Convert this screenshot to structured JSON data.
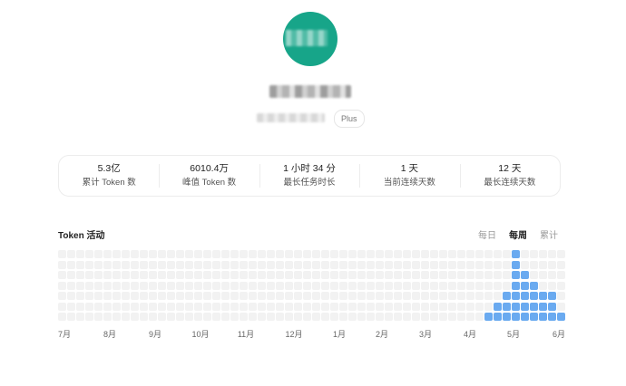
{
  "profile": {
    "plan_badge": "Plus"
  },
  "stats": [
    {
      "value": "5.3亿",
      "label": "累计 Token 数"
    },
    {
      "value": "6010.4万",
      "label": "峰值 Token 数"
    },
    {
      "value": "1 小时 34 分",
      "label": "最长任务时长"
    },
    {
      "value": "1 天",
      "label": "当前连续天数"
    },
    {
      "value": "12 天",
      "label": "最长连续天数"
    }
  ],
  "activity": {
    "title": "Token 活动",
    "tabs": [
      {
        "label": "每日",
        "active": false
      },
      {
        "label": "每周",
        "active": true
      },
      {
        "label": "累计",
        "active": false
      }
    ],
    "weeks": 56,
    "rows": 7,
    "active_cells": [
      [
        47,
        6
      ],
      [
        48,
        5
      ],
      [
        48,
        6
      ],
      [
        49,
        4
      ],
      [
        49,
        5
      ],
      [
        49,
        6
      ],
      [
        50,
        0
      ],
      [
        50,
        1
      ],
      [
        50,
        2
      ],
      [
        50,
        3
      ],
      [
        50,
        4
      ],
      [
        50,
        5
      ],
      [
        50,
        6
      ],
      [
        51,
        2
      ],
      [
        51,
        3
      ],
      [
        51,
        4
      ],
      [
        51,
        5
      ],
      [
        51,
        6
      ],
      [
        52,
        3
      ],
      [
        52,
        4
      ],
      [
        52,
        5
      ],
      [
        52,
        6
      ],
      [
        53,
        4
      ],
      [
        53,
        5
      ],
      [
        53,
        6
      ],
      [
        54,
        4
      ],
      [
        54,
        5
      ],
      [
        54,
        6
      ],
      [
        55,
        6
      ]
    ],
    "months": [
      {
        "label": "7月",
        "week": 0.5
      },
      {
        "label": "8月",
        "week": 5.5
      },
      {
        "label": "9月",
        "week": 10.5
      },
      {
        "label": "10月",
        "week": 15.5
      },
      {
        "label": "11月",
        "week": 20.5
      },
      {
        "label": "12月",
        "week": 25.8
      },
      {
        "label": "1月",
        "week": 30.8
      },
      {
        "label": "2月",
        "week": 35.5
      },
      {
        "label": "3月",
        "week": 40.3
      },
      {
        "label": "4月",
        "week": 45.2
      },
      {
        "label": "5月",
        "week": 50.0
      },
      {
        "label": "6月",
        "week": 55.0
      }
    ],
    "colors": {
      "active": "#6aaaf0",
      "inactive": "#f2f2f2"
    }
  }
}
